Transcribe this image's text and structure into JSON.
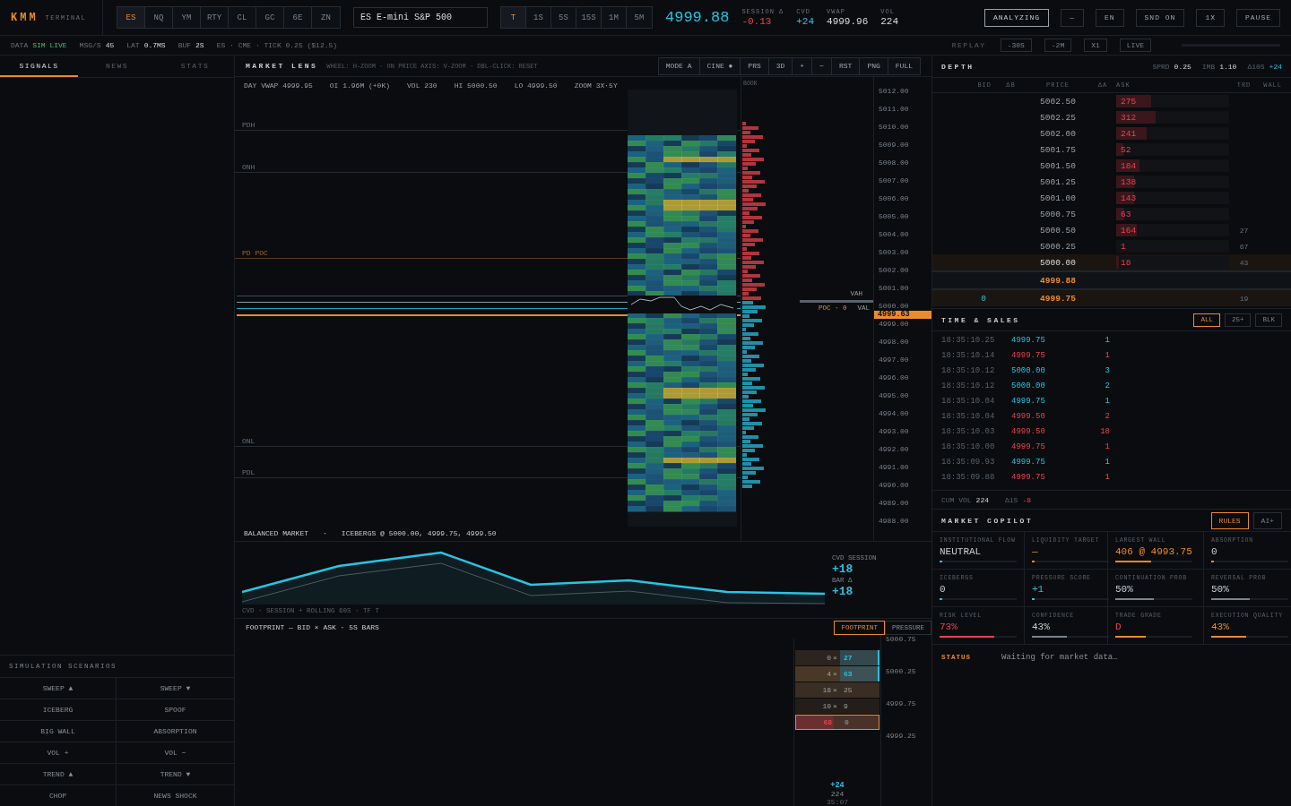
{
  "brand": {
    "logo": "KMM",
    "subtitle": "TERMINAL"
  },
  "symbols": [
    {
      "label": "ES",
      "selected": true
    },
    {
      "label": "NQ",
      "selected": false
    },
    {
      "label": "YM",
      "selected": false
    },
    {
      "label": "RTY",
      "selected": false
    },
    {
      "label": "CL",
      "selected": false
    },
    {
      "label": "GC",
      "selected": false
    },
    {
      "label": "6E",
      "selected": false
    },
    {
      "label": "ZN",
      "selected": false
    }
  ],
  "instrument": {
    "value": "ES E-mini S&P 500"
  },
  "timeframes": [
    {
      "label": "T",
      "selected": true
    },
    {
      "label": "1S",
      "selected": false
    },
    {
      "label": "5S",
      "selected": false
    },
    {
      "label": "15S",
      "selected": false
    },
    {
      "label": "1M",
      "selected": false
    },
    {
      "label": "5M",
      "selected": false
    }
  ],
  "last_price": "4999.88",
  "quote_stats": [
    {
      "label": "SESSION Δ",
      "value": "-0.13",
      "kind": "down"
    },
    {
      "label": "CVD",
      "value": "+24",
      "kind": "up"
    },
    {
      "label": "VWAP",
      "value": "4999.96",
      "kind": "plain"
    },
    {
      "label": "VOL",
      "value": "224",
      "kind": "plain"
    }
  ],
  "header_buttons": [
    {
      "label": "ANALYZING",
      "active": true
    },
    {
      "label": "—",
      "active": false
    },
    {
      "label": "EN",
      "active": false
    },
    {
      "label": "SND ON",
      "active": false
    },
    {
      "label": "1X",
      "active": false
    },
    {
      "label": "PAUSE",
      "active": false
    }
  ],
  "status_bar": {
    "items": [
      {
        "label": "DATA",
        "value": "SIM LIVE",
        "kind": "live"
      },
      {
        "label": "MSG/S",
        "value": "45",
        "kind": "plain"
      },
      {
        "label": "LAT",
        "value": "0.7MS",
        "kind": "plain"
      },
      {
        "label": "BUF",
        "value": "2S",
        "kind": "plain"
      }
    ],
    "feed": "ES · CME · TICK 0.25 ($12.5)",
    "replay_label": "REPLAY",
    "replay_buttons": [
      "-30S",
      "-2M",
      "X1",
      "LIVE"
    ]
  },
  "left_tabs": [
    {
      "label": "SIGNALS",
      "selected": true
    },
    {
      "label": "NEWS",
      "selected": false
    },
    {
      "label": "STATS",
      "selected": false
    }
  ],
  "simulation": {
    "title": "SIMULATION SCENARIOS",
    "buttons": [
      "SWEEP ▲",
      "SWEEP ▼",
      "ICEBERG",
      "SPOOF",
      "BIG WALL",
      "ABSORPTION",
      "VOL +",
      "VOL −",
      "TREND ▲",
      "TREND ▼",
      "CHOP",
      "NEWS SHOCK"
    ]
  },
  "market_lens": {
    "title": "MARKET LENS",
    "hint": "WHEEL: H-ZOOM · ON PRICE AXIS: V-ZOOM · DBL-CLICK: RESET",
    "tools": [
      "MODE A",
      "CINE ●",
      "PRS",
      "3D",
      "+",
      "−",
      "RST",
      "PNG",
      "FULL"
    ],
    "stats": [
      "DAY VWAP 4999.95",
      "OI 1.96M (+0K)",
      "VOL 230",
      "HI 5000.50",
      "LO 4999.50",
      "ZOOM 3X·5Y"
    ],
    "levels": [
      {
        "label": "PDH",
        "kind": "ref"
      },
      {
        "label": "ONH",
        "kind": "ref"
      },
      {
        "label": "PD POC",
        "kind": "poc"
      },
      {
        "label": "ONL",
        "kind": "ref"
      },
      {
        "label": "PDL",
        "kind": "ref"
      }
    ],
    "book_label": "BOOK",
    "value_area": {
      "high": "VAH",
      "poc": "POC · 0",
      "low": "VAL"
    },
    "axis": [
      "5012.00",
      "5011.00",
      "5010.00",
      "5009.00",
      "5008.00",
      "5007.00",
      "5006.00",
      "5005.00",
      "5004.00",
      "5003.00",
      "5002.00",
      "5001.00",
      "5000.00",
      "4999.00",
      "4998.00",
      "4997.00",
      "4996.00",
      "4995.00",
      "4994.00",
      "4993.00",
      "4992.00",
      "4991.00",
      "4990.00",
      "4989.00",
      "4988.00"
    ],
    "current_price": "4999.63",
    "footer": {
      "regime": "BALANCED MARKET",
      "separator": "·",
      "icebergs": "ICEBERGS @ 5000.00, 4999.75, 4999.50"
    }
  },
  "cvd": {
    "caption": "CVD · SESSION + ROLLING 60S · TF T",
    "session_label": "CVD SESSION",
    "session_value": "+18",
    "bar_label": "BAR Δ",
    "bar_value": "+18"
  },
  "footprint": {
    "title": "FOOTPRINT — BID × ASK · 5S BARS",
    "tabs": [
      {
        "label": "FOOTPRINT",
        "selected": true
      },
      {
        "label": "PRESSURE",
        "selected": false
      }
    ],
    "rows": [
      {
        "bid": "0",
        "sep": "×",
        "ask": "27",
        "kind": "buy"
      },
      {
        "bid": "4",
        "sep": "×",
        "ask": "63",
        "kind": "buy"
      },
      {
        "bid": "18",
        "sep": "×",
        "ask": "25",
        "kind": "neutral"
      },
      {
        "bid": "10",
        "sep": "×",
        "ask": "9",
        "kind": "dim"
      },
      {
        "bid": "68",
        "ask": "0",
        "kind": "sell"
      }
    ],
    "axis": [
      "5000.75",
      "5000.25",
      "4999.75",
      "4999.25"
    ],
    "delta": "+24",
    "volume": "224",
    "time": "35:07"
  },
  "depth": {
    "title": "DEPTH",
    "stats": [
      {
        "label": "SPRD",
        "value": "0.25",
        "kind": "plain"
      },
      {
        "label": "IMB",
        "value": "1.10",
        "kind": "plain"
      },
      {
        "label": "Δ10S",
        "value": "+24",
        "kind": "up"
      }
    ],
    "columns": [
      "BID",
      "ΔB",
      "PRICE",
      "ΔA",
      "ASK",
      "TRD",
      "WALL"
    ],
    "rows": [
      {
        "kind": "ask",
        "price": "5002.50",
        "ask": "275",
        "level": 0.31,
        "highlighted": false
      },
      {
        "kind": "ask",
        "price": "5002.25",
        "ask": "312",
        "level": 0.35,
        "highlighted": false
      },
      {
        "kind": "ask",
        "price": "5002.00",
        "ask": "241",
        "level": 0.27,
        "highlighted": false
      },
      {
        "kind": "ask",
        "price": "5001.75",
        "ask": "52",
        "level": 0.06,
        "highlighted": false
      },
      {
        "kind": "ask",
        "price": "5001.50",
        "ask": "184",
        "level": 0.21,
        "highlighted": false
      },
      {
        "kind": "ask",
        "price": "5001.25",
        "ask": "138",
        "level": 0.16,
        "highlighted": false
      },
      {
        "kind": "ask",
        "price": "5001.00",
        "ask": "143",
        "level": 0.16,
        "highlighted": false
      },
      {
        "kind": "ask",
        "price": "5000.75",
        "ask": "63",
        "level": 0.07,
        "highlighted": false
      },
      {
        "kind": "ask",
        "price": "5000.50",
        "ask": "164",
        "trd": "27",
        "level": 0.18,
        "highlighted": false
      },
      {
        "kind": "ask",
        "price": "5000.25",
        "ask": "1",
        "trd": "67",
        "highlighted": false
      },
      {
        "kind": "ask",
        "price": "5000.00",
        "ask": "18",
        "trd": "43",
        "level": 0.02,
        "highlighted": true
      },
      {
        "kind": "mid",
        "price": "4999.88"
      },
      {
        "kind": "bid",
        "price": "4999.75",
        "bid": "0",
        "trd": "19",
        "highlighted": true
      }
    ]
  },
  "time_sales": {
    "title": "TIME & SALES",
    "filters": [
      {
        "label": "ALL",
        "selected": true
      },
      {
        "label": "25+",
        "selected": false
      },
      {
        "label": "BLK",
        "selected": false
      }
    ],
    "rows": [
      {
        "time": "18:35:10.25",
        "price": "4999.75",
        "size": "1",
        "kind": "up"
      },
      {
        "time": "18:35:10.14",
        "price": "4999.75",
        "size": "1",
        "kind": "down"
      },
      {
        "time": "18:35:10.12",
        "price": "5000.00",
        "size": "3",
        "kind": "up"
      },
      {
        "time": "18:35:10.12",
        "price": "5000.00",
        "size": "2",
        "kind": "up"
      },
      {
        "time": "18:35:10.04",
        "price": "4999.75",
        "size": "1",
        "kind": "up"
      },
      {
        "time": "18:35:10.04",
        "price": "4999.50",
        "size": "2",
        "kind": "down"
      },
      {
        "time": "18:35:10.03",
        "price": "4999.50",
        "size": "18",
        "kind": "down"
      },
      {
        "time": "18:35:10.00",
        "price": "4999.75",
        "size": "1",
        "kind": "down"
      },
      {
        "time": "18:35:09.93",
        "price": "4999.75",
        "size": "1",
        "kind": "up"
      },
      {
        "time": "18:35:09.88",
        "price": "4999.75",
        "size": "1",
        "kind": "down"
      }
    ],
    "footer": [
      {
        "label": "CUM VOL",
        "value": "224",
        "kind": "plain"
      },
      {
        "label": "Δ1S",
        "value": "-8",
        "kind": "down"
      }
    ]
  },
  "copilot": {
    "title": "MARKET COPILOT",
    "modes": [
      {
        "label": "RULES",
        "selected": true
      },
      {
        "label": "AI+",
        "selected": false
      }
    ],
    "cells": [
      {
        "label": "INSTITUTIONAL FLOW",
        "value": "NEUTRAL",
        "kind": "plain",
        "color": "#27c2e0",
        "level": 0.03
      },
      {
        "label": "LIQUIDITY TARGET",
        "value": "—",
        "kind": "accent",
        "color": "#ec8a2c",
        "level": 0.04
      },
      {
        "label": "LARGEST WALL",
        "value": "406 @ 4993.75",
        "kind": "accent",
        "color": "#ec8a2c",
        "level": 0.46
      },
      {
        "label": "ABSORPTION",
        "value": "0",
        "kind": "plain",
        "color": "#ec8a2c",
        "level": 0.03
      },
      {
        "label": "ICEBERGS",
        "value": "0",
        "kind": "plain",
        "color": "#27c2e0",
        "level": 0.03
      },
      {
        "label": "PRESSURE SCORE",
        "value": "+1",
        "kind": "accent",
        "color": "#27c2e0",
        "level": 0.03
      },
      {
        "label": "CONTINUATION PROB",
        "value": "50%",
        "kind": "plain",
        "color": "#7c838c",
        "level": 0.5
      },
      {
        "label": "REVERSAL PROB",
        "value": "50%",
        "kind": "plain",
        "color": "#7c838c",
        "level": 0.5
      },
      {
        "label": "RISK LEVEL",
        "value": "73%",
        "kind": "accent",
        "color": "#e8434d",
        "level": 0.71
      },
      {
        "label": "CONFIDENCE",
        "value": "43%",
        "kind": "plain",
        "color": "#7c838c",
        "level": 0.45
      },
      {
        "label": "TRADE GRADE",
        "value": "D",
        "kind": "alert",
        "color": "#ec8a2c",
        "level": 0.4
      },
      {
        "label": "EXECUTION QUALITY",
        "value": "43%",
        "kind": "accent",
        "color": "#ec8a2c",
        "level": 0.45
      }
    ],
    "status_label": "STATUS",
    "status_text": "Waiting for market data…"
  }
}
